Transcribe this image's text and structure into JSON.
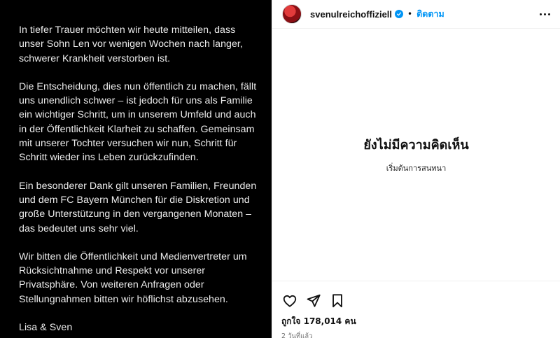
{
  "post": {
    "paragraphs": [
      "In tiefer Trauer möchten wir heute mitteilen, dass unser Sohn Len vor wenigen Wochen nach langer, schwerer Krankheit verstorben ist.",
      "Die Entscheidung, dies nun öffentlich zu machen, fällt uns unendlich schwer – ist jedoch für uns als Familie ein wichtiger Schritt, um in unserem Umfeld und auch in der Öffentlichkeit Klarheit zu schaffen. Gemeinsam mit unserer Tochter versuchen wir nun, Schritt für Schritt wieder ins Leben zurückzufinden.",
      "Ein besonderer Dank gilt unseren Familien, Freunden und dem FC Bayern München für die Diskretion und große Unterstützung in den vergangenen Monaten – das bedeutet uns sehr viel.",
      "Wir bitten die Öffentlichkeit und Medienvertreter um Rücksichtnahme und Respekt vor unserer Privatsphäre. Von weiteren Anfragen oder Stellungnahmen bitten wir höflichst abzusehen.",
      "Lisa & Sven"
    ]
  },
  "header": {
    "username": "svenulreichoffiziell",
    "separator": "•",
    "follow_label": "ติดตาม",
    "verified": true
  },
  "comments": {
    "empty_title": "ยังไม่มีความคิดเห็น",
    "empty_subtitle": "เริ่มต้นการสนทนา"
  },
  "footer": {
    "likes": "ถูกใจ 178,014 คน",
    "time": "2 วันที่แล้ว"
  },
  "icons": {
    "like": "heart-outline-icon",
    "share": "paper-plane-icon",
    "save": "bookmark-outline-icon",
    "more": "more-horizontal-icon",
    "verified": "verified-badge-icon"
  },
  "colors": {
    "accent": "#0095f6",
    "image_bg": "#000000",
    "image_text": "#ececec"
  }
}
